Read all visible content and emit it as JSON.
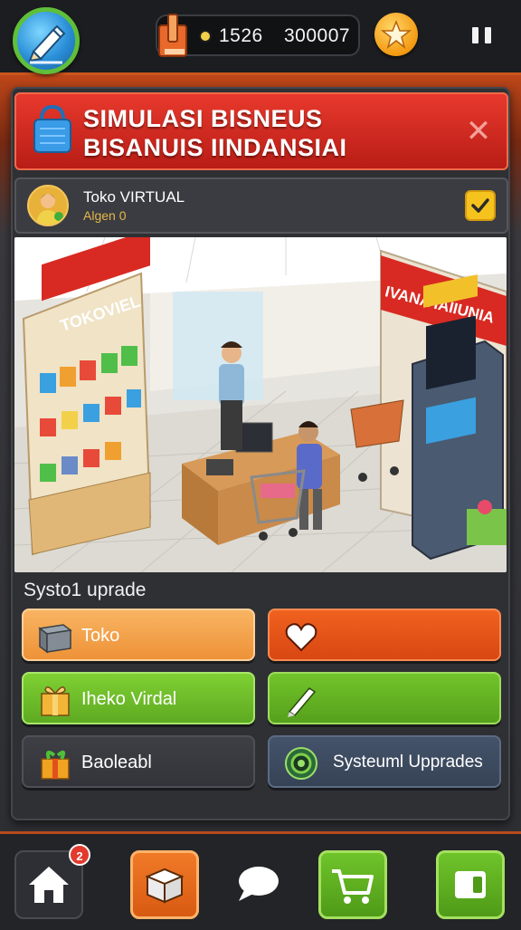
{
  "topbar": {
    "currency_1": "1526",
    "currency_2": "300007"
  },
  "banner": {
    "title_line1": "SIMULASI BISNEUS",
    "title_line2": "BISANUIS IINDANSIAI",
    "close_glyph": "✕"
  },
  "store": {
    "name": "Toko VIRTUAL",
    "subtitle": "Algen 0",
    "checked": true
  },
  "scene": {
    "sign_left": "TOKOVIEL",
    "sign_right": "IVANA IAIIUNIA"
  },
  "upgrades": {
    "section_title": "Systo1 uprade",
    "tiles": [
      {
        "label": "Toko",
        "icon": "cart-box-icon",
        "color": "#f4a24a"
      },
      {
        "label": "",
        "icon": "heart-icon",
        "color": "#e0521c"
      },
      {
        "label": "Iheko Virdal",
        "icon": "gift-box-icon",
        "color": "#6fbf2a"
      },
      {
        "label": "",
        "icon": "pen-icon",
        "color": "#62ad24"
      },
      {
        "label": "Baoleabl",
        "icon": "gift-icon",
        "color": "#3a3b40"
      },
      {
        "label": "Systeuml Upprades",
        "icon": "target-icon",
        "color": "#3d4a57"
      }
    ]
  },
  "bottomnav": {
    "badge_count": "2",
    "items": [
      "home-icon",
      "box-icon",
      "chat-icon",
      "shopping-cart-icon",
      "card-icon"
    ]
  },
  "colors": {
    "accent_orange": "#e0521c",
    "accent_green": "#6fbf2a",
    "banner_red": "#d12a20",
    "gold": "#f6c21e"
  }
}
